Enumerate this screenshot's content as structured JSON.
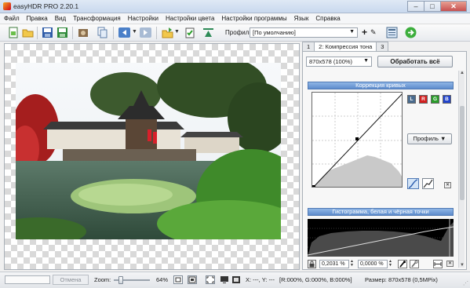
{
  "window": {
    "title": "easyHDR PRO 2.20.1",
    "minimize": "–",
    "maximize": "□",
    "close": "✕"
  },
  "menu": [
    "Файл",
    "Правка",
    "Вид",
    "Трансформация",
    "Настройки",
    "Настройки цвета",
    "Настройки программы",
    "Язык",
    "Справка"
  ],
  "toolbar": {
    "icons": [
      "new-image-icon",
      "open-folder-icon",
      "save-icon",
      "save-as-icon",
      "batch-icon",
      "copy-icon",
      "undo-icon",
      "redo-icon",
      "load-settings-icon",
      "save-settings-icon",
      "reset-settings-icon",
      "add-profile-icon",
      "edit-profile-icon",
      "preview-panel-icon",
      "process-go-icon"
    ],
    "profile_label": "Профиль:",
    "profile_value": "[По умолчанию]",
    "add_symbol": "+",
    "edit_symbol": "✎"
  },
  "panel": {
    "tabs": [
      "1",
      "2: Компрессия тона",
      "3"
    ],
    "active_tab": 1,
    "size_value": "870x578 (100%)",
    "process_all_label": "Обработать всё",
    "curves_header": "Коррекция кривых",
    "channels": [
      {
        "label": "L",
        "color": "#4a6b8e"
      },
      {
        "label": "R",
        "color": "#d32020"
      },
      {
        "label": "G",
        "color": "#2a9d2a"
      },
      {
        "label": "B",
        "color": "#2244cc"
      }
    ],
    "profile_button": "Профиль ▼",
    "histogram_header": "Гистограмма, белая и чёрная точки",
    "black_point": "0,2031 %",
    "white_point": "0,0000 %",
    "pct_symbol": "%"
  },
  "status": {
    "cancel_label": "Отмена",
    "zoom_label": "Zoom:",
    "zoom_value": "64%",
    "zoom_level": 0.2,
    "coords": "X: ---, Y: ---",
    "rgb": "[R:000%, G:000%, B:000%]",
    "size": "Размер: 870x578 (0,5MPix)"
  },
  "colors": {
    "accent_header": "#5e8ccc",
    "titlebar": "#c9d9ee"
  }
}
